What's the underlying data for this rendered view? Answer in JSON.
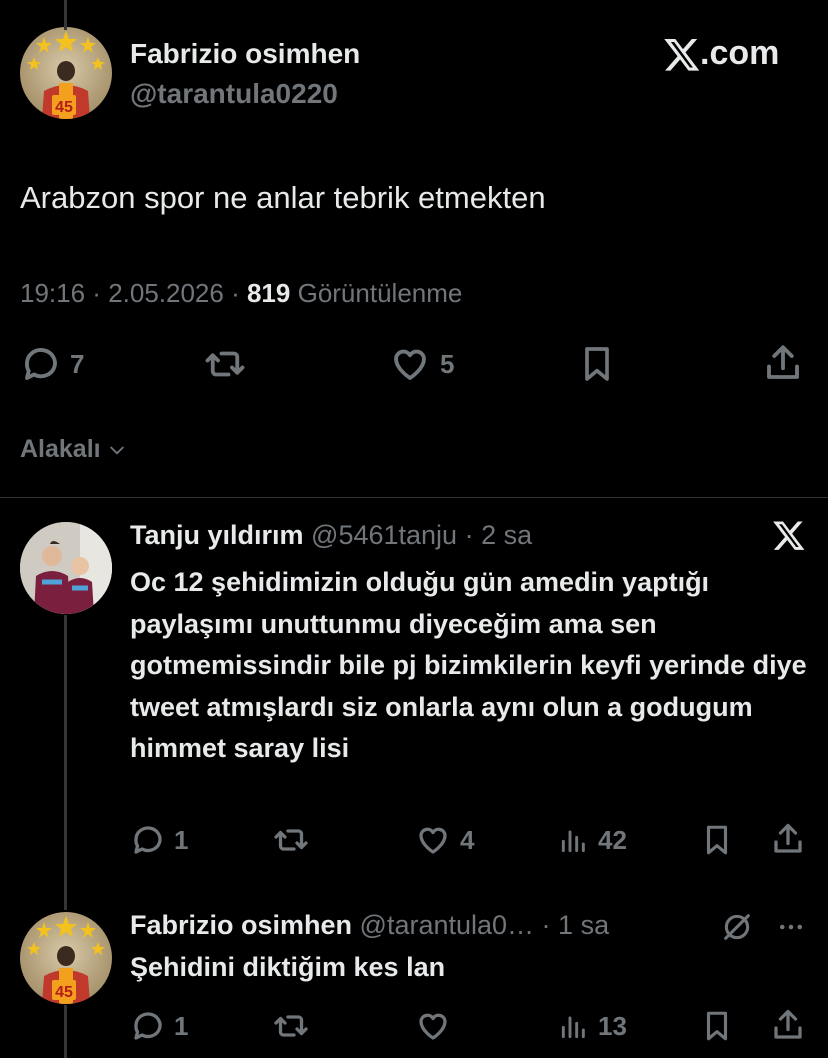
{
  "main_tweet": {
    "display_name": "Fabrizio osimhen",
    "handle": "@tarantula0220",
    "brand": "X.com",
    "text": "Arabzon spor ne anlar tebrik etmekten",
    "time": "19:16",
    "date": "2.05.2026",
    "views_count": "819",
    "views_label": "Görüntülenme",
    "replies": "7",
    "likes": "5",
    "avatar_jersey_number": "45"
  },
  "sort": {
    "label": "Alakalı"
  },
  "reply_1": {
    "display_name": "Tanju yıldırım",
    "handle": "@5461tanju",
    "age": "2 sa",
    "text": "Oc 12 şehidimizin olduğu gün amedin yaptığı paylaşımı unuttunmu diyeceğim ama sen gotmemissindir bile pj bizimkilerin keyfi yerinde diye tweet atmışlardı siz onlarla aynı olun a godugum himmet saray lisi",
    "replies": "1",
    "likes": "4",
    "views": "42"
  },
  "reply_2": {
    "display_name": "Fabrizio osimhen",
    "handle": "@tarantula0…",
    "age": "1 sa",
    "text": "Şehidini diktiğim kes lan",
    "replies": "1",
    "views": "13",
    "avatar_jersey_number": "45"
  },
  "colors": {
    "background": "#000000",
    "text": "#e7e9ea",
    "muted": "#71767b",
    "divider": "#2f3336"
  },
  "icons": [
    "reply-icon",
    "retweet-icon",
    "like-icon",
    "bookmark-icon",
    "share-icon",
    "views-icon",
    "x-logo-icon",
    "chevron-down-icon",
    "mute-icon",
    "more-icon"
  ]
}
